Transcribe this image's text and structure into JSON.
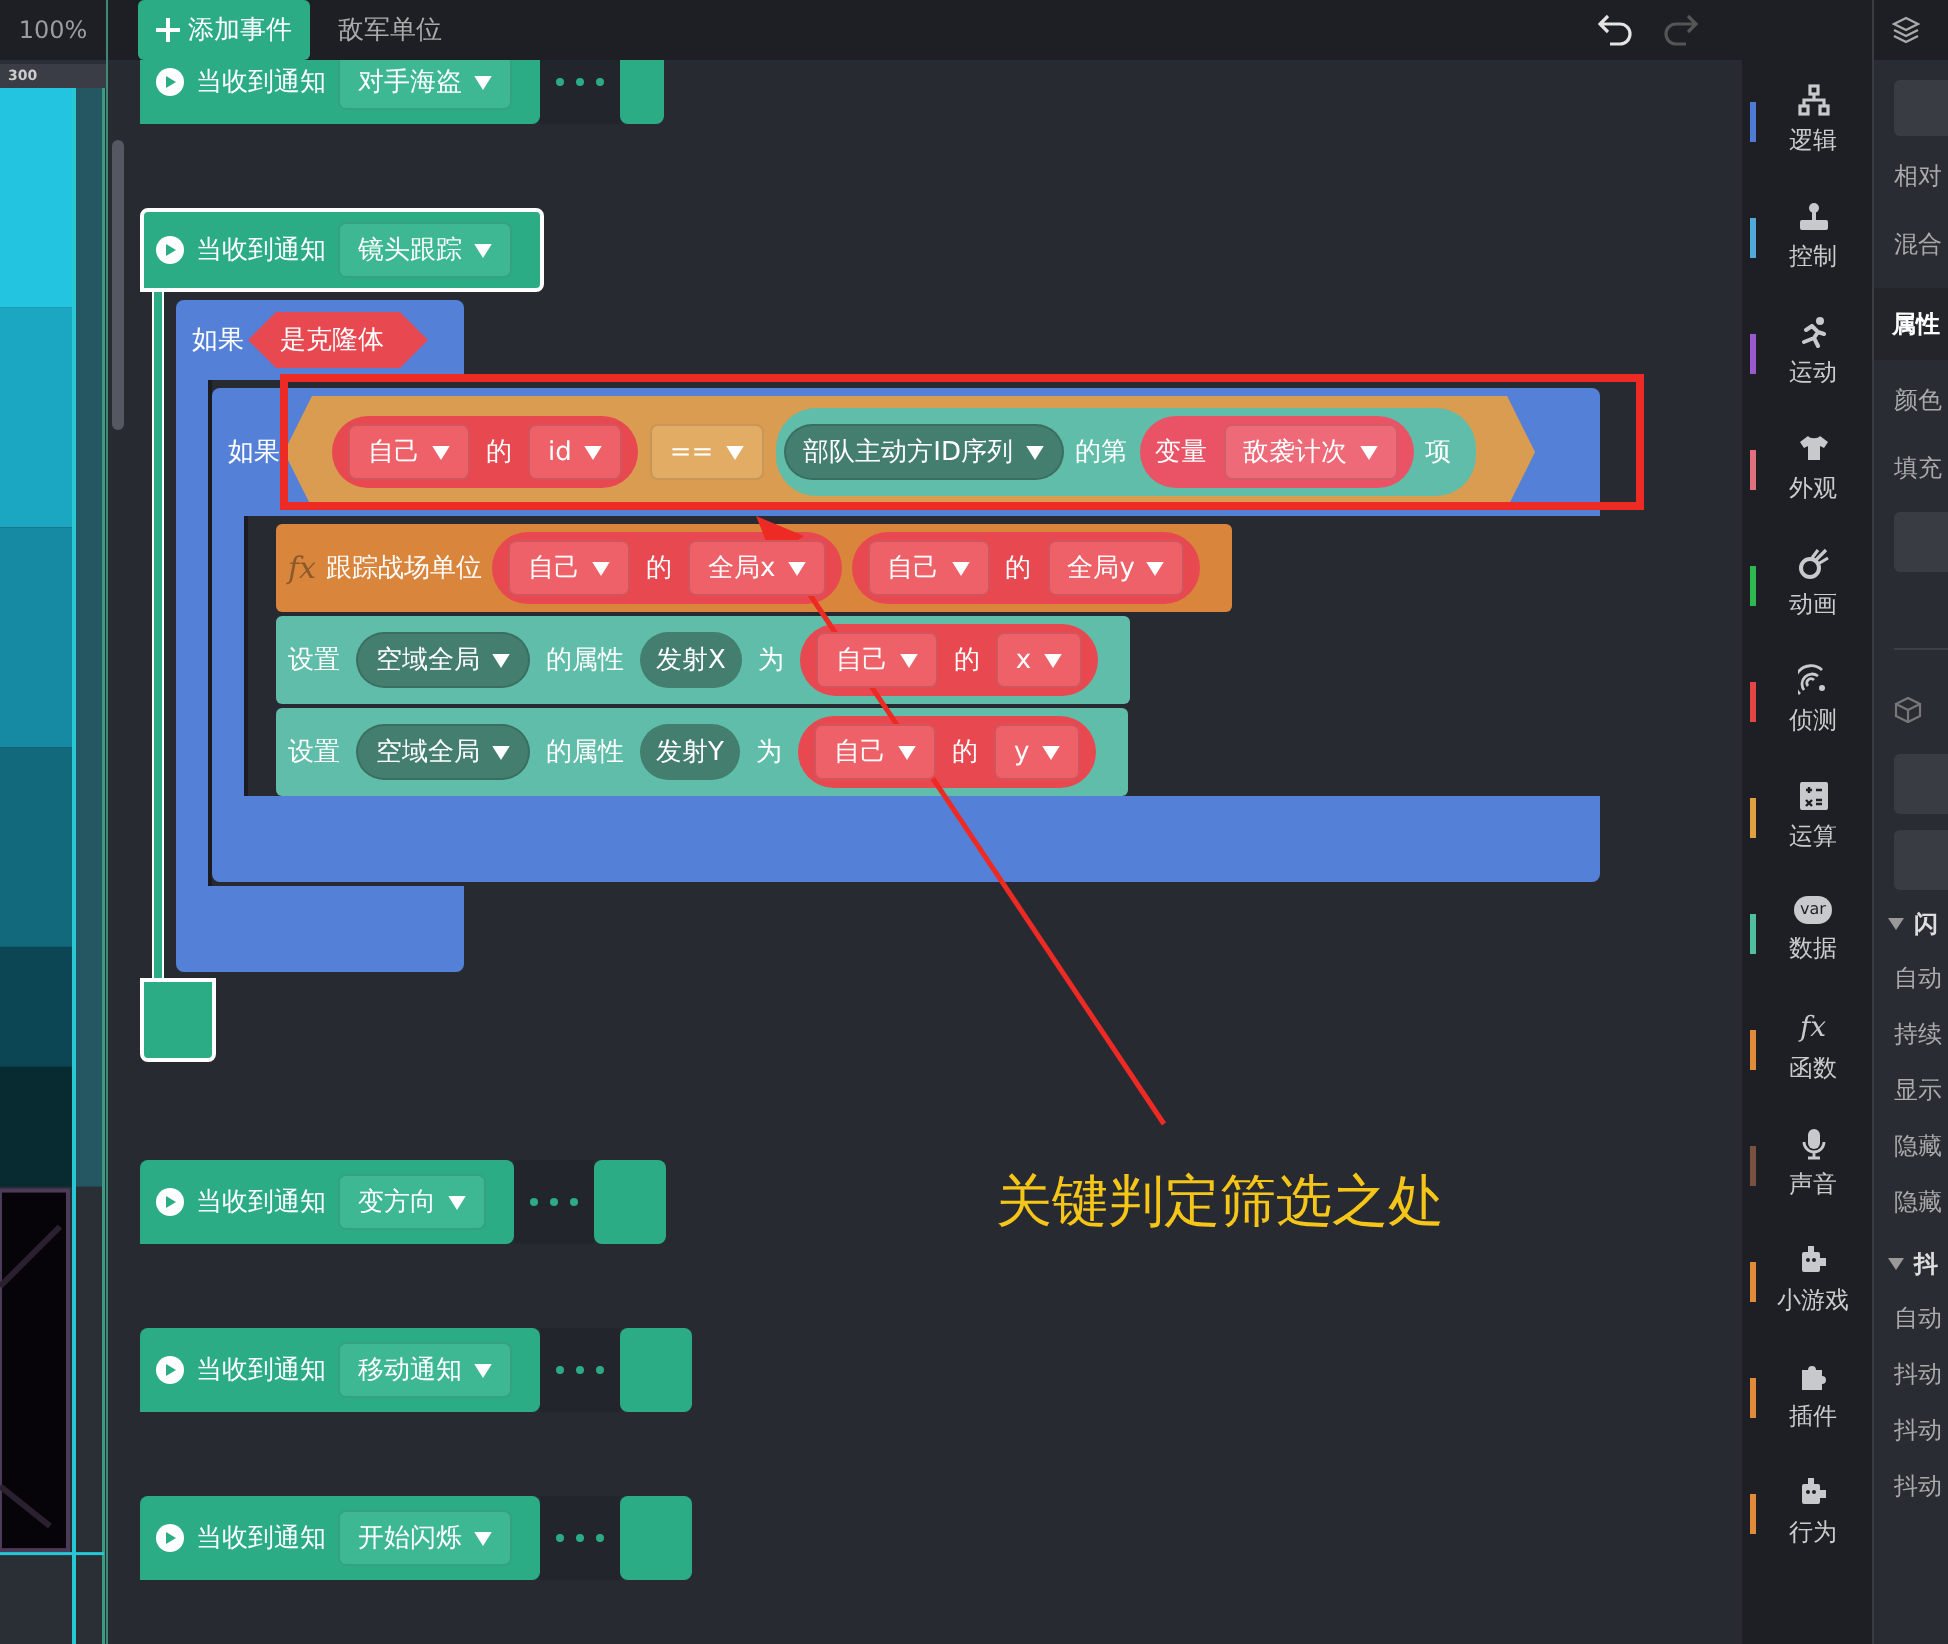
{
  "zoom": "100%",
  "ruler": "300",
  "toolbar": {
    "add_button": "添加事件",
    "target": "敌军单位",
    "undo_disabled": false,
    "redo_disabled": true
  },
  "scripts": [
    {
      "label": "当收到通知",
      "option": "对手海盗",
      "selected": false,
      "collapsed": true
    },
    {
      "label": "当收到通知",
      "option": "镜头跟踪",
      "selected": true,
      "collapsed": false,
      "body": [
        {
          "kind": "if",
          "label": "如果",
          "condition": {
            "kind": "boolean",
            "parts": [
              {
                "kind": "text",
                "text": "是克隆体"
              }
            ]
          },
          "children": [
            {
              "kind": "if",
              "label": "如果",
              "condition": {
                "kind": "compare",
                "parts": [
                  {
                    "kind": "getter",
                    "parts": [
                      {
                        "kind": "menu",
                        "text": "自己"
                      },
                      {
                        "kind": "text",
                        "text": "的"
                      },
                      {
                        "kind": "menu",
                        "text": "id"
                      }
                    ]
                  },
                  {
                    "kind": "operator",
                    "text": "=="
                  },
                  {
                    "kind": "list-item",
                    "parts": [
                      {
                        "kind": "list",
                        "text": "部队主动方ID序列"
                      },
                      {
                        "kind": "text",
                        "text": "的第"
                      },
                      {
                        "kind": "variable",
                        "parts": [
                          {
                            "kind": "text",
                            "text": "变量"
                          },
                          {
                            "kind": "menu",
                            "text": "敌袭计次"
                          }
                        ]
                      },
                      {
                        "kind": "text",
                        "text": "项"
                      }
                    ]
                  }
                ]
              },
              "children": [
                {
                  "kind": "call",
                  "parts": [
                    {
                      "kind": "glyph",
                      "text": "fx"
                    },
                    {
                      "kind": "text",
                      "text": "跟踪战场单位"
                    },
                    {
                      "kind": "getter",
                      "parts": [
                        {
                          "kind": "menu",
                          "text": "自己"
                        },
                        {
                          "kind": "text",
                          "text": "的"
                        },
                        {
                          "kind": "menu",
                          "text": "全局x"
                        }
                      ]
                    },
                    {
                      "kind": "getter",
                      "parts": [
                        {
                          "kind": "menu",
                          "text": "自己"
                        },
                        {
                          "kind": "text",
                          "text": "的"
                        },
                        {
                          "kind": "menu",
                          "text": "全局y"
                        }
                      ]
                    }
                  ]
                },
                {
                  "kind": "set",
                  "parts": [
                    {
                      "kind": "text",
                      "text": "设置"
                    },
                    {
                      "kind": "list",
                      "text": "空域全局"
                    },
                    {
                      "kind": "text",
                      "text": "的属性"
                    },
                    {
                      "kind": "field",
                      "text": "发射X"
                    },
                    {
                      "kind": "text",
                      "text": "为"
                    },
                    {
                      "kind": "getter",
                      "parts": [
                        {
                          "kind": "menu",
                          "text": "自己"
                        },
                        {
                          "kind": "text",
                          "text": "的"
                        },
                        {
                          "kind": "menu",
                          "text": "x"
                        }
                      ]
                    }
                  ]
                },
                {
                  "kind": "set",
                  "parts": [
                    {
                      "kind": "text",
                      "text": "设置"
                    },
                    {
                      "kind": "list",
                      "text": "空域全局"
                    },
                    {
                      "kind": "text",
                      "text": "的属性"
                    },
                    {
                      "kind": "field",
                      "text": "发射Y"
                    },
                    {
                      "kind": "text",
                      "text": "为"
                    },
                    {
                      "kind": "getter",
                      "parts": [
                        {
                          "kind": "menu",
                          "text": "自己"
                        },
                        {
                          "kind": "text",
                          "text": "的"
                        },
                        {
                          "kind": "menu",
                          "text": "y"
                        }
                      ]
                    }
                  ]
                }
              ]
            }
          ]
        }
      ]
    },
    {
      "label": "当收到通知",
      "option": "变方向",
      "selected": false,
      "collapsed": true
    },
    {
      "label": "当收到通知",
      "option": "移动通知",
      "selected": false,
      "collapsed": true
    },
    {
      "label": "当收到通知",
      "option": "开始闪烁",
      "selected": false,
      "collapsed": true
    }
  ],
  "categories": [
    {
      "label": "逻辑",
      "color": "#4f7bd6"
    },
    {
      "label": "控制",
      "color": "#4fa9d9"
    },
    {
      "label": "运动",
      "color": "#9b59d0"
    },
    {
      "label": "外观",
      "color": "#e0707c"
    },
    {
      "label": "动画",
      "color": "#2fb84f"
    },
    {
      "label": "侦测",
      "color": "#e34444"
    },
    {
      "label": "运算",
      "color": "#e0a040"
    },
    {
      "label": "数据",
      "color": "#4fbfa0",
      "glyph": "var"
    },
    {
      "label": "函数",
      "color": "#e08a3a",
      "glyph": "fx"
    },
    {
      "label": "声音",
      "color": "#7a5040"
    },
    {
      "label": "小游戏",
      "color": "#e08a3a"
    },
    {
      "label": "插件",
      "color": "#e08a3a"
    },
    {
      "label": "行为",
      "color": "#e08a3a"
    }
  ],
  "inspector": [
    {
      "kind": "button"
    },
    {
      "kind": "label",
      "text": "相对"
    },
    {
      "kind": "label",
      "text": "混合"
    },
    {
      "kind": "tab",
      "text": "属性"
    },
    {
      "kind": "label",
      "text": "颜色"
    },
    {
      "kind": "label",
      "text": "填充"
    },
    {
      "kind": "blank"
    },
    {
      "kind": "divider"
    },
    {
      "kind": "section"
    },
    {
      "kind": "blank"
    },
    {
      "kind": "blank"
    },
    {
      "kind": "group",
      "text": "闪"
    },
    {
      "kind": "label",
      "text": "自动"
    },
    {
      "kind": "label",
      "text": "持续"
    },
    {
      "kind": "label",
      "text": "显示"
    },
    {
      "kind": "label",
      "text": "隐藏"
    },
    {
      "kind": "label",
      "text": "隐藏"
    },
    {
      "kind": "group",
      "text": "抖"
    },
    {
      "kind": "label",
      "text": "自动"
    },
    {
      "kind": "label",
      "text": "抖动"
    },
    {
      "kind": "label",
      "text": "抖动"
    },
    {
      "kind": "label",
      "text": "抖动"
    }
  ],
  "annotation": {
    "label": "关键判定筛选之处"
  }
}
